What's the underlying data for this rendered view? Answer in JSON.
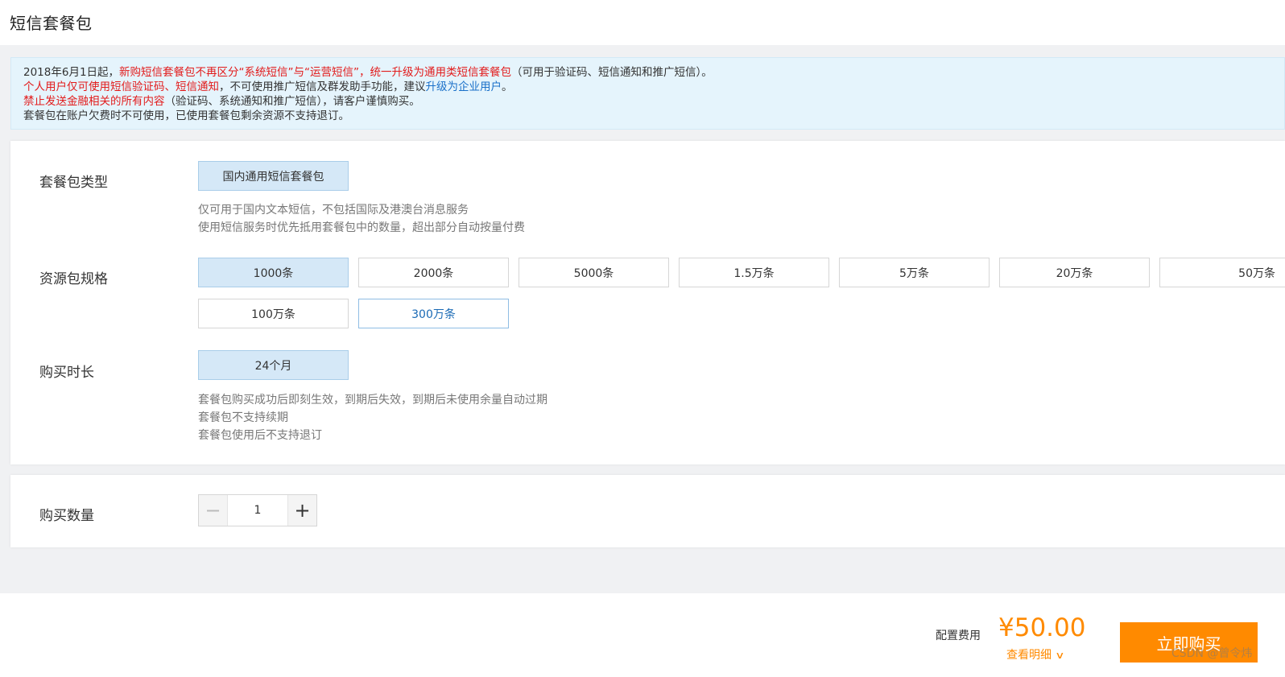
{
  "header": {
    "title": "短信套餐包"
  },
  "notice": {
    "line1": {
      "prefix": "2018年6月1日起，",
      "highlight": "新购短信套餐包不再区分“系统短信”与“运营短信”，统一升级为通用类短信套餐包",
      "suffix": "（可用于验证码、短信通知和推广短信）。"
    },
    "line2": {
      "highlight": "个人用户仅可使用短信验证码、短信通知",
      "middle": "，不可使用推广短信及群发助手功能，建议",
      "link": "升级为企业用户",
      "suffix": "。"
    },
    "line3": {
      "highlight": "禁止发送金融相关的所有内容",
      "suffix": "（验证码、系统通知和推广短信），请客户谨慎购买。"
    },
    "line4": "套餐包在账户欠费时不可使用，已使用套餐包剩余资源不支持退订。"
  },
  "package_type": {
    "label": "套餐包类型",
    "option": "国内通用短信套餐包",
    "desc1": "仅可用于国内文本短信，不包括国际及港澳台消息服务",
    "desc2": "使用短信服务时优先抵用套餐包中的数量，超出部分自动按量付费"
  },
  "spec": {
    "label": "资源包规格",
    "options": [
      "1000条",
      "2000条",
      "5000条",
      "1.5万条",
      "5万条",
      "20万条",
      "50万条",
      "100万条",
      "300万条"
    ],
    "selected": "1000条"
  },
  "duration": {
    "label": "购买时长",
    "option": "24个月",
    "desc1": "套餐包购买成功后即刻生效，到期后失效，到期后未使用余量自动过期",
    "desc2": "套餐包不支持续期",
    "desc3": "套餐包使用后不支持退订"
  },
  "quantity": {
    "label": "购买数量",
    "value": "1",
    "minus": "−",
    "plus": "+"
  },
  "footer": {
    "cost_label": "配置费用",
    "price": "¥50.00",
    "detail_link": "查看明细",
    "detail_chevron": "∨",
    "buy_button": "立即购买",
    "watermark": "CSDN @曾令炜"
  },
  "colors": {
    "accent_orange": "#ff8a00",
    "notice_red": "#e21b1b",
    "link_blue": "#1a70c9",
    "selected_bg": "#d5e8f7"
  }
}
